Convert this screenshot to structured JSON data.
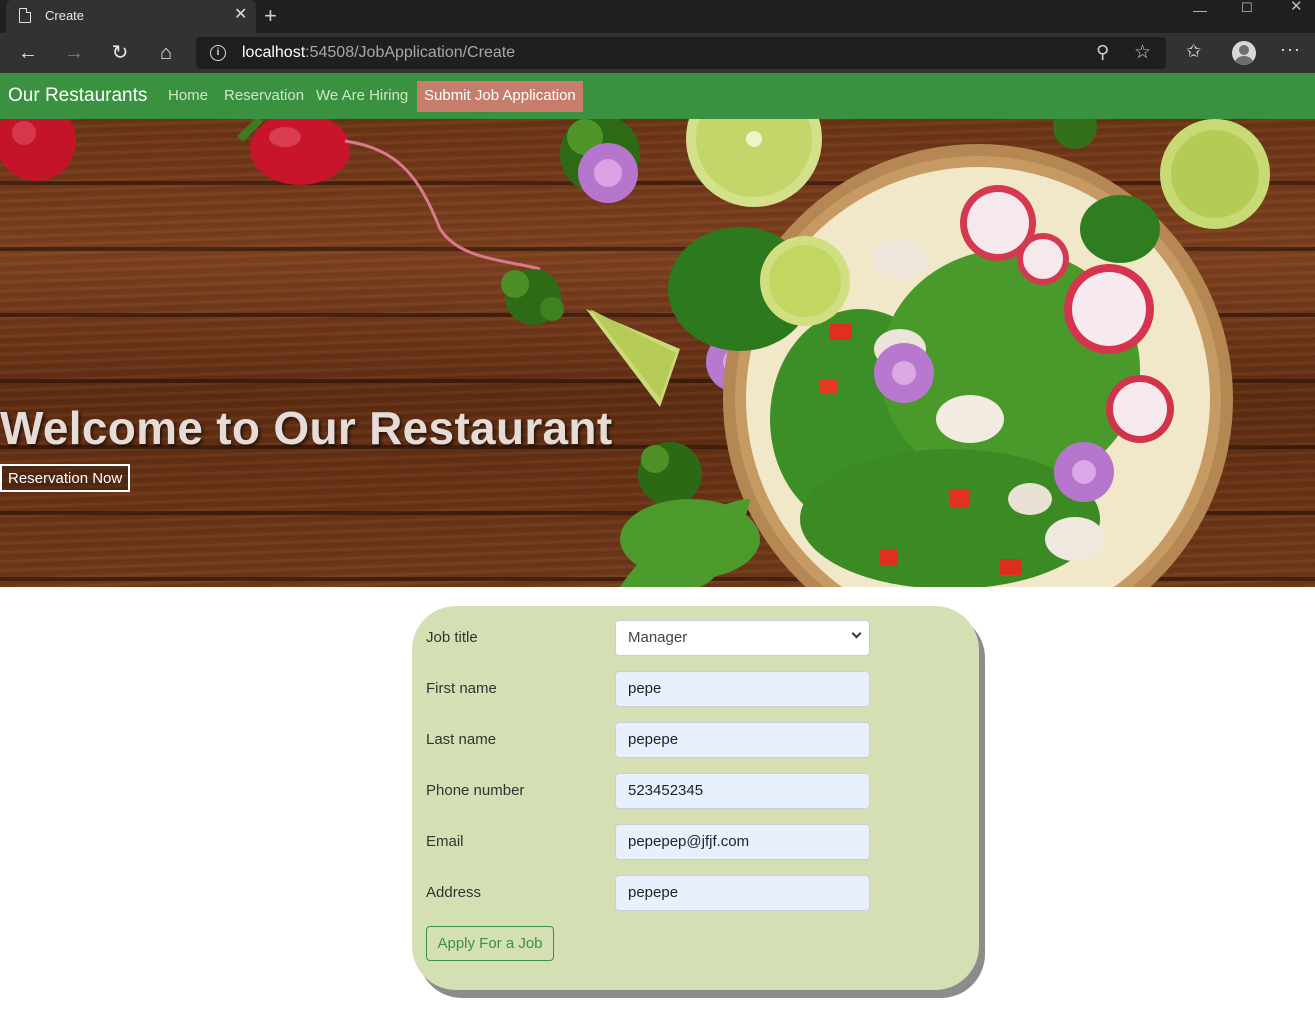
{
  "browser": {
    "tab_title": "Create",
    "url_host": "localhost",
    "url_path": ":54508/JobApplication/Create",
    "icons": [
      "page-icon",
      "close-icon",
      "new-tab-icon",
      "back-icon",
      "forward-icon",
      "refresh-icon",
      "home-icon",
      "info-icon",
      "zoom-icon",
      "favorite-star-icon",
      "collections-icon",
      "profile-avatar",
      "more-icon",
      "minimize-icon",
      "maximize-icon",
      "window-close-icon"
    ]
  },
  "navbar": {
    "brand": "Our Restaurants",
    "links": [
      "Home",
      "Reservation",
      "We Are Hiring",
      "Submit Job Application"
    ],
    "active_link": "Submit Job Application",
    "colors": {
      "background": "#3a9140",
      "active": "#c67d6c"
    }
  },
  "hero": {
    "title": "Welcome to Our Restaurant",
    "button": "Reservation Now"
  },
  "form": {
    "fields": [
      {
        "label": "Job title",
        "value": "Manager",
        "type": "select"
      },
      {
        "label": "First name",
        "value": "pepe"
      },
      {
        "label": "Last name",
        "value": "pepepe"
      },
      {
        "label": "Phone number",
        "value": "523452345"
      },
      {
        "label": "Email",
        "value": "pepepep@jfjf.com"
      },
      {
        "label": "Address",
        "value": "pepepe"
      }
    ],
    "submit": "Apply For a Job",
    "colors": {
      "card": "#d4e0b4",
      "field": "#e8f0fe"
    }
  }
}
